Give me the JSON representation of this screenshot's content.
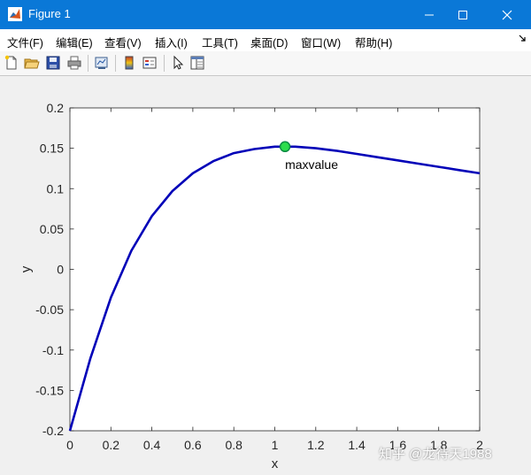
{
  "window": {
    "title": "Figure 1"
  },
  "menu": {
    "items": [
      "文件(F)",
      "编辑(E)",
      "查看(V)",
      "插入(I)",
      "工具(T)",
      "桌面(D)",
      "窗口(W)",
      "帮助(H)"
    ]
  },
  "toolbar": {
    "icons": [
      "new-figure-icon",
      "open-file-icon",
      "save-icon",
      "print-icon",
      "link-plot-icon",
      "colorbar-icon",
      "legend-icon",
      "edit-plot-icon",
      "property-inspector-icon"
    ]
  },
  "colors": {
    "titlebar": "#0a78d7",
    "line": "#0000b8",
    "marker_fill": "#2bdd4b",
    "marker_edge": "#0d8c44"
  },
  "chart_data": {
    "type": "line",
    "xlabel": "x",
    "ylabel": "y",
    "xlim": [
      0,
      2
    ],
    "ylim": [
      -0.2,
      0.2
    ],
    "xticks": [
      "0",
      "0.2",
      "0.4",
      "0.6",
      "0.8",
      "1",
      "1.2",
      "1.4",
      "1.6",
      "1.8",
      "2"
    ],
    "yticks": [
      "-0.2",
      "-0.15",
      "-0.1",
      "-0.05",
      "0",
      "0.05",
      "0.1",
      "0.15",
      "0.2"
    ],
    "series": [
      {
        "x": [
          0,
          0.1,
          0.2,
          0.3,
          0.4,
          0.5,
          0.6,
          0.7,
          0.8,
          0.9,
          1.0,
          1.1,
          1.2,
          1.3,
          1.4,
          1.5,
          1.6,
          1.7,
          1.8,
          1.9,
          2.0
        ],
        "y": [
          -0.2,
          -0.11,
          -0.035,
          0.023,
          0.066,
          0.097,
          0.119,
          0.134,
          0.144,
          0.149,
          0.152,
          0.152,
          0.15,
          0.147,
          0.143,
          0.139,
          0.135,
          0.131,
          0.127,
          0.123,
          0.119
        ]
      }
    ],
    "max_point": {
      "x": 1.05,
      "y": 0.152,
      "label": "maxvalue"
    }
  },
  "watermark": "知乎 @龙待天1988"
}
